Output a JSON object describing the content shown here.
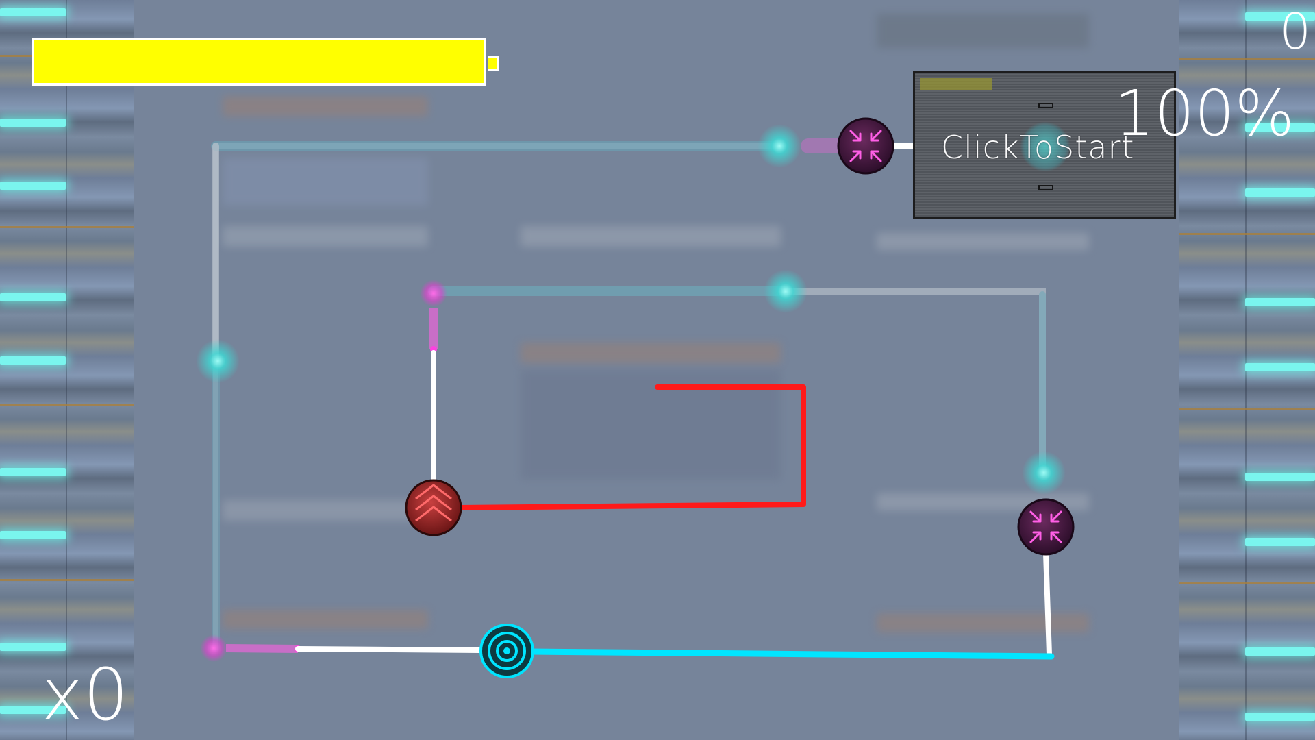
{
  "hud": {
    "score": "0",
    "accuracy": "100%",
    "combo": "x0",
    "health_fraction": 1.0
  },
  "preview": {
    "label": "ClickToStart"
  },
  "colors": {
    "health": "#ffff00",
    "glow": "#7af5ee",
    "red_path": "#ff1a1a",
    "cyan_path": "#00e5ff",
    "magenta": "#ff40e0"
  },
  "notes": [
    {
      "name": "upward-arrow-note",
      "icon": "chevrons-up-icon",
      "color": "#e84040"
    },
    {
      "name": "compress-note-top",
      "icon": "compress-arrows-icon",
      "color": "#ff40e0"
    },
    {
      "name": "compress-note-right",
      "icon": "compress-arrows-icon",
      "color": "#ff40e0"
    },
    {
      "name": "target-note",
      "icon": "target-rings-icon",
      "color": "#00e5ff"
    }
  ]
}
